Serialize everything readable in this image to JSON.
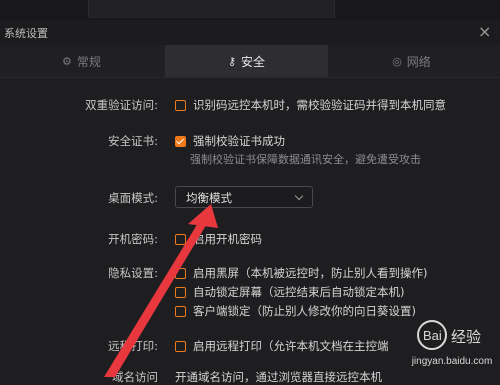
{
  "window": {
    "title": "系统设置"
  },
  "tabs": [
    {
      "label": "常规",
      "icon": "gear-icon"
    },
    {
      "label": "安全",
      "icon": "key-icon"
    },
    {
      "label": "网络",
      "icon": "globe-icon"
    }
  ],
  "settings": {
    "dual_verification": {
      "label": "双重验证访问:",
      "option": "识别码远控本机时，需校验验证码并得到本机同意",
      "checked": false
    },
    "security_cert": {
      "label": "安全证书:",
      "option": "强制校验证书成功",
      "checked": true,
      "hint": "强制校验证书保障数据通讯安全，避免遭受攻击"
    },
    "desktop_mode": {
      "label": "桌面模式:",
      "value": "均衡模式"
    },
    "boot_password": {
      "label": "开机密码:",
      "option": "启用开机密码",
      "checked": false
    },
    "privacy": {
      "label": "隐私设置:",
      "options": [
        {
          "text": "启用黑屏（本机被远控时，防止别人看到操作)",
          "checked": false
        },
        {
          "text": "自动锁定屏幕（远控结束后自动锁定本机)",
          "checked": false
        },
        {
          "text": "客户端锁定（防止别人修改你的向日葵设置)",
          "checked": false
        }
      ]
    },
    "remote_print": {
      "label": "远程打印:",
      "option": "启用远程打印（允许本机文档在主控端",
      "checked": false
    },
    "partial_row": {
      "label": "域名访问",
      "option": "开通域名访问，通过浏览器直接远控本机"
    }
  },
  "colors": {
    "accent": "#ee7a1c",
    "arrow": "#e8383d"
  },
  "watermark": {
    "brand": "Bai 经验",
    "url": "jingyan.baidu.com"
  }
}
